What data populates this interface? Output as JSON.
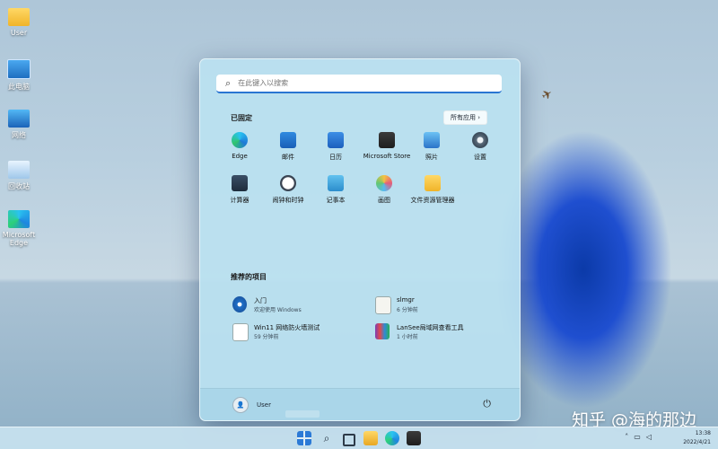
{
  "desktop": {
    "icons": [
      {
        "label": "User",
        "icon": "folder-icon"
      },
      {
        "label": "此电脑",
        "icon": "computer-icon"
      },
      {
        "label": "网络",
        "icon": "network-icon"
      },
      {
        "label": "回收站",
        "icon": "recycle-bin-icon"
      },
      {
        "label": "Microsoft Edge",
        "icon": "edge-icon"
      }
    ],
    "watermark": "知乎 @海的那边"
  },
  "start_menu": {
    "search_placeholder": "在此键入以搜索",
    "pinned_title": "已固定",
    "all_apps_label": "所有应用",
    "pinned_apps": [
      {
        "label": "Edge",
        "icon": "edge-icon"
      },
      {
        "label": "邮件",
        "icon": "mail-icon"
      },
      {
        "label": "日历",
        "icon": "calendar-icon"
      },
      {
        "label": "Microsoft Store",
        "icon": "store-icon"
      },
      {
        "label": "照片",
        "icon": "photos-icon"
      },
      {
        "label": "设置",
        "icon": "settings-icon"
      },
      {
        "label": "计算器",
        "icon": "calculator-icon"
      },
      {
        "label": "闹钟和时钟",
        "icon": "clock-icon"
      },
      {
        "label": "记事本",
        "icon": "notepad-icon"
      },
      {
        "label": "画图",
        "icon": "paint-icon"
      },
      {
        "label": "文件资源管理器",
        "icon": "file-explorer-icon"
      }
    ],
    "recommended_title": "推荐的项目",
    "recommended": [
      {
        "name": "入门",
        "sub": "欢迎使用 Windows",
        "icon": "get-started-icon"
      },
      {
        "name": "slmgr",
        "sub": "6 分钟前",
        "icon": "script-file-icon"
      },
      {
        "name": "Win11 网络防火墙测试",
        "sub": "59 分钟前",
        "icon": "document-icon"
      },
      {
        "name": "LanSee局域网查看工具",
        "sub": "1 小时前",
        "icon": "winrar-icon"
      }
    ],
    "user_name": "User"
  },
  "taskbar": {
    "items": [
      "start-icon",
      "search-icon",
      "task-view-icon",
      "file-explorer-icon",
      "edge-icon",
      "store-icon"
    ],
    "tray_icons": [
      "chevron-up-icon",
      "network-icon",
      "volume-icon"
    ],
    "time": "13:38",
    "date": "2022/4/21"
  }
}
